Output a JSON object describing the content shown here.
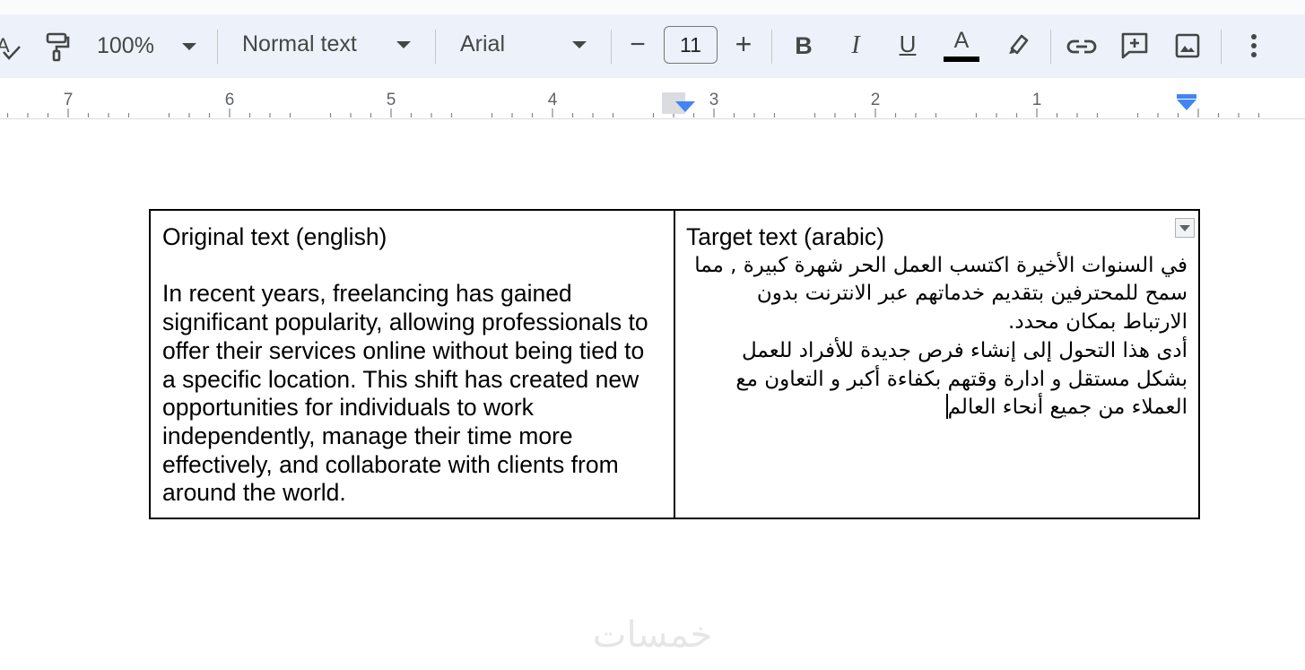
{
  "toolbar": {
    "zoom": "100%",
    "style": "Normal text",
    "font": "Arial",
    "font_size": "11",
    "decrease_symbol": "−",
    "increase_symbol": "+",
    "bold": "B",
    "italic": "I",
    "underline": "U",
    "text_color": "A",
    "text_color_value": "#000000",
    "icons": [
      "spellcheck-icon",
      "paint-format-icon",
      "link-icon",
      "add-comment-icon",
      "insert-image-icon",
      "more-icon",
      "highlighter-icon"
    ]
  },
  "ruler": {
    "numbers": [
      "7",
      "6",
      "5",
      "4",
      "3",
      "2",
      "1"
    ]
  },
  "table": {
    "left_title": "Original text (english)",
    "left_body": "In recent years, freelancing has gained significant popularity, allowing professionals to offer their services online without being tied to a specific location. This shift has created new opportunities for individuals to work independently, manage their time more effectively, and collaborate with clients from around the world.",
    "right_title": "Target text (arabic)",
    "right_para1": "في السنوات الأخيرة اكتسب العمل الحر شهرة كبيرة , مما سمح للمحترفين بتقديم خدماتهم عبر الانترنت بدون الارتباط بمكان محدد.",
    "right_para2": "أدى هذا التحول إلى إنشاء فرص جديدة للأفراد للعمل بشكل مستقل و ادارة وقتهم بكفاءة أكبر و التعاون مع العملاء من جميع أنحاء العالم"
  },
  "watermark": "خمسات"
}
